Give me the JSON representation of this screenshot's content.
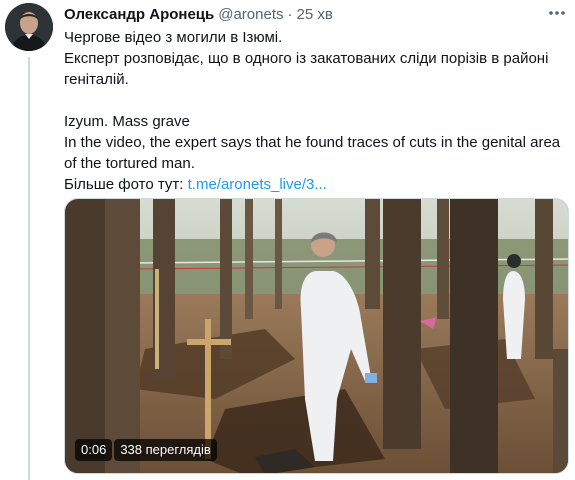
{
  "tweet": {
    "author_name": "Олександр Аронець",
    "author_handle": "@aronets",
    "separator": "·",
    "time": "25 хв",
    "more_icon": "more-icon",
    "text_uk_line1": "Чергове відео з могили в Ізюмі.",
    "text_uk_line2": "Експерт розповідає, що в одного із закатованих сліди порізів в районі геніталій.",
    "text_en_line1": "Izyum. Mass grave",
    "text_en_line2": "In the video, the expert says that he found traces of cuts in the genital area of the tortured man.",
    "more_photos_label": "Більше фото тут:",
    "more_photos_link": "t.me/aronets_live/3..."
  },
  "video": {
    "duration": "0:06",
    "views": "338 переглядів"
  }
}
